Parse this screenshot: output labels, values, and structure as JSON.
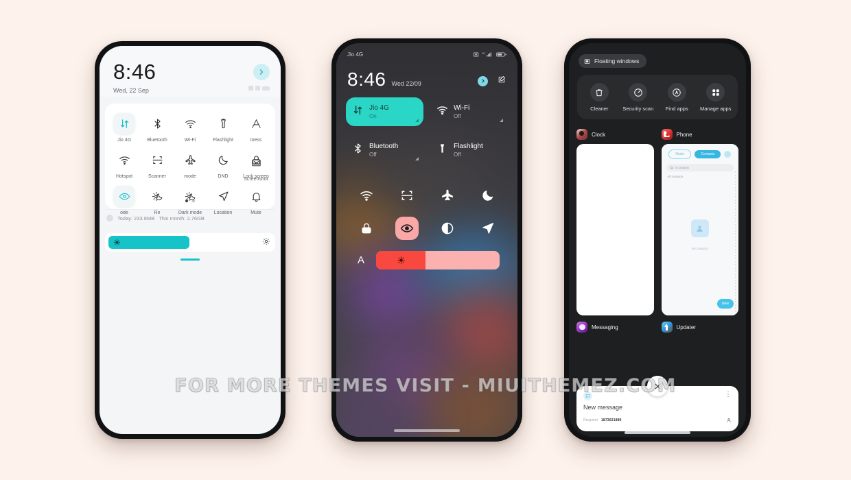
{
  "watermark": "FOR MORE THEMES VISIT - MIUITHEMEZ.COM",
  "colors": {
    "page_background": "#fdf2ec",
    "accent_teal": "#15c3c9",
    "accent_cyan_tile": "#2ad6c6",
    "accent_red": "#f8483f",
    "accent_pink": "#fcb1b1",
    "dark_panel": "#2a2b2d"
  },
  "phone1": {
    "time": "8:46",
    "date": "Wed, 22 Sep",
    "expand_icon": "chevron-right-icon",
    "tiles": [
      {
        "label": "Jio 4G",
        "icon": "data-transfer-icon",
        "active": true
      },
      {
        "label": "Bluetooth",
        "icon": "bluetooth-icon",
        "active": false
      },
      {
        "label": "Wi-Fi",
        "icon": "wifi-icon",
        "active": false
      },
      {
        "label": "Flashlight",
        "icon": "flashlight-icon",
        "active": false
      },
      {
        "label": "tness",
        "icon": "font-size-a-icon",
        "active": false
      },
      {
        "label": "Hotspot",
        "icon": "hotspot-icon",
        "active": false
      },
      {
        "label": "Scanner",
        "icon": "scanner-icon",
        "active": false
      },
      {
        "label": "mode",
        "icon": "airplane-icon",
        "active": false
      },
      {
        "label": "DND",
        "icon": "moon-icon",
        "active": false
      },
      {
        "label": "Lock screen",
        "icon": "lock-icon",
        "active": false
      },
      {
        "label": "ode",
        "icon": "eye-icon",
        "active": true
      },
      {
        "label": "Re",
        "icon": "sun-moon-icon",
        "active": false
      },
      {
        "label": "Dark mode",
        "icon": "dark-mode-icon",
        "active": false
      },
      {
        "label": "Location",
        "icon": "location-arrow-icon",
        "active": false
      },
      {
        "label": "Mute",
        "icon": "bell-icon",
        "active": false
      },
      {
        "label": "Screenshot",
        "icon": "screenshot-icon",
        "active": false
      }
    ],
    "page_dots": {
      "count": 2,
      "active_index": 0
    },
    "data_usage_today": "Today: 233.8MB",
    "data_usage_month": "This month: 2.76GB",
    "brightness_percent": 45
  },
  "phone2": {
    "carrier": "Jio 4G",
    "status_icons": [
      "screenshot-icon",
      "signal-4g-icon",
      "battery-icon"
    ],
    "time": "8:46",
    "date": "Wed 22/09",
    "expand_icon": "chevron-right-icon",
    "edit_icon": "edit-pencil-icon",
    "big_tiles": [
      {
        "label": "Jio 4G",
        "state": "On",
        "icon": "data-transfer-icon",
        "active": true
      },
      {
        "label": "Wi-Fi",
        "state": "Off",
        "icon": "wifi-icon",
        "active": false
      },
      {
        "label": "Bluetooth",
        "state": "Off",
        "icon": "bluetooth-icon",
        "active": false
      },
      {
        "label": "Flashlight",
        "state": "Off",
        "icon": "flashlight-icon",
        "active": false
      }
    ],
    "small_tiles": [
      {
        "icon": "hotspot-icon",
        "active": false
      },
      {
        "icon": "scanner-icon",
        "active": false
      },
      {
        "icon": "airplane-icon",
        "active": false
      },
      {
        "icon": "moon-icon",
        "active": false
      },
      {
        "icon": "lock-icon",
        "active": false
      },
      {
        "icon": "eye-icon",
        "active": true
      },
      {
        "icon": "contrast-icon",
        "active": false
      },
      {
        "icon": "location-arrow-icon",
        "active": false
      }
    ],
    "brightness_auto_label": "A",
    "brightness_percent": 40
  },
  "phone3": {
    "floating_windows_label": "Floating windows",
    "floating_windows_icon": "floating-window-icon",
    "tools": [
      {
        "label": "Cleaner",
        "icon": "trash-icon"
      },
      {
        "label": "Security scan",
        "icon": "shield-scan-icon"
      },
      {
        "label": "Find apps",
        "icon": "search-circle-icon"
      },
      {
        "label": "Manage apps",
        "icon": "grid-apps-icon"
      }
    ],
    "recent_apps": [
      {
        "name": "Clock",
        "icon_color": "#d94a4a"
      },
      {
        "name": "Phone",
        "icon_color": "#e23b3b"
      },
      {
        "name": "Messaging",
        "icon_color": "#8e44c8"
      },
      {
        "name": "Updater",
        "icon_color": "#3fa9f5"
      }
    ],
    "phone_preview": {
      "tab_dialer": "Dialer",
      "tab_contacts": "Contacts",
      "search_placeholder": "0 contacts",
      "search_icon": "search-icon",
      "subtitle": "All contacts",
      "empty_text": "No contacts",
      "fab_label": "New"
    },
    "message_sheet": {
      "title": "New message",
      "icon": "messaging-icon",
      "more_icon": "more-vertical-icon",
      "recipient_label": "Recipient",
      "recipient_value": "1873021880",
      "contact_picker_icon": "person-icon",
      "close_icon": "close-icon"
    }
  }
}
